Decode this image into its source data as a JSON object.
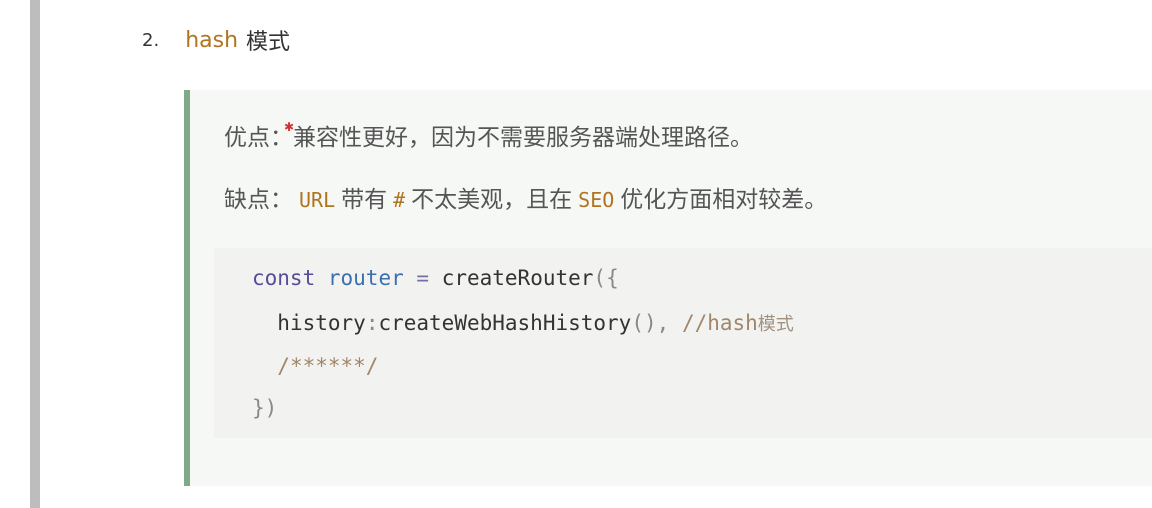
{
  "heading": {
    "number": "2.",
    "keyword": "hash",
    "text": "模式"
  },
  "tip": {
    "pros": {
      "label": "优点：",
      "text": "兼容性更好，因为不需要服务器端处理路径。"
    },
    "cons": {
      "label": "缺点：",
      "code1": "URL",
      "text1": "带有",
      "code2": "#",
      "text2": "不太美观，且在",
      "code3": "SEO",
      "text3": "优化方面相对较差。"
    }
  },
  "code_block": {
    "line1": {
      "keyword": "const",
      "var": "router",
      "op": "=",
      "call": "createRouter",
      "open": "({"
    },
    "line2": {
      "prop": "history",
      "colon": ":",
      "call": "createWebHashHistory",
      "parens": "(),",
      "comment": "//hash",
      "comment_zh": "模式"
    },
    "line3": {
      "comment": "/******/"
    },
    "line4": {
      "close": "})"
    }
  },
  "colors": {
    "accent_code": "#b0741f",
    "tip_border": "#7fa987",
    "tip_bg": "#f6f8f6"
  }
}
